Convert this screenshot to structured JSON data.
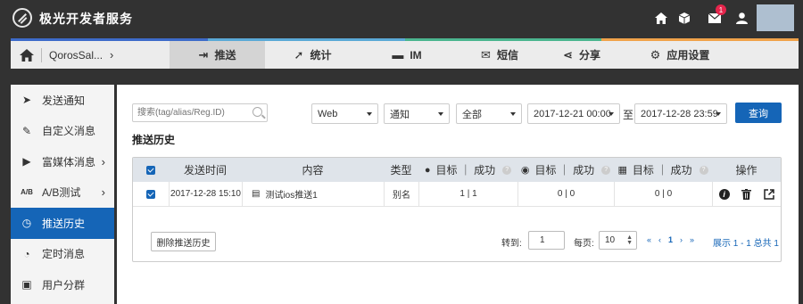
{
  "topbar": {
    "brand": "极光开发者服务",
    "mail_badge": "1",
    "icons": [
      "home-icon",
      "cube-icon",
      "mail-icon",
      "user-icon"
    ]
  },
  "nav": {
    "breadcrumb": "QorosSal...",
    "tabs": [
      {
        "label": "推送",
        "icon": "sign-in-icon",
        "active": true
      },
      {
        "label": "统计",
        "icon": "chart-icon",
        "active": false
      },
      {
        "label": "IM",
        "icon": "chat-icon",
        "active": false
      },
      {
        "label": "短信",
        "icon": "sms-icon",
        "active": false
      },
      {
        "label": "分享",
        "icon": "share-icon",
        "active": false
      },
      {
        "label": "应用设置",
        "icon": "gear-icon",
        "active": false
      }
    ],
    "strip_colors": [
      "#3d6bc9",
      "#5aa9d6",
      "#4bb58f",
      "#f0a24a"
    ]
  },
  "sidebar": {
    "items": [
      {
        "label": "发送通知",
        "icon": "send-icon"
      },
      {
        "label": "自定义消息",
        "icon": "edit-icon"
      },
      {
        "label": "富媒体消息",
        "icon": "media-icon",
        "has_children": true
      },
      {
        "label": "A/B测试",
        "icon": "ab-icon",
        "has_children": true
      },
      {
        "label": "推送历史",
        "icon": "clock-icon",
        "active": true
      },
      {
        "label": "定时消息",
        "icon": "timer-icon"
      },
      {
        "label": "用户分群",
        "icon": "group-icon"
      }
    ]
  },
  "filters": {
    "search_placeholder": "搜索(tag/alias/Reg.ID)",
    "platform": "Web",
    "message_type": "通知",
    "scope": "全部",
    "start_time": "2017-12-21 00:00",
    "to_label": "至",
    "end_time": "2017-12-28 23:59",
    "query_button": "查询"
  },
  "section_title": "推送历史",
  "table": {
    "headers": {
      "send_time": "发送时间",
      "content": "内容",
      "type": "类型",
      "ios": "目标 ｜ 成功",
      "android": "目标 ｜ 成功",
      "windows": "目标 ｜ 成功",
      "actions": "操作"
    },
    "rows": [
      {
        "send_time": "2017-12-28 15:10",
        "content": "测试ios推送1",
        "type": "别名",
        "ios": "1 | 1",
        "android": "0 | 0",
        "windows": "0 | 0"
      }
    ]
  },
  "footer": {
    "delete_button": "删除推送历史",
    "goto_label": "转到:",
    "goto_value": "1",
    "per_page_label": "每页:",
    "per_page_value": "10",
    "pager": [
      "«",
      "‹",
      "1",
      "›",
      "»"
    ],
    "summary": "展示 1 - 1 总共 1"
  }
}
